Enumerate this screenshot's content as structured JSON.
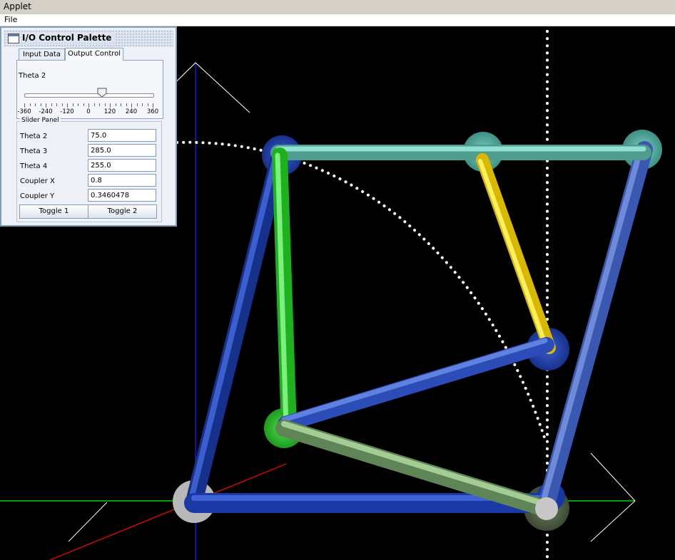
{
  "window": {
    "title": "Applet"
  },
  "menu": {
    "file_label": "File"
  },
  "palette": {
    "title": "I/O Control Palette",
    "tabs": [
      {
        "label": "Input Data"
      },
      {
        "label": "Output Control"
      }
    ],
    "active_tab": "Output Control",
    "slider": {
      "label": "Theta 2",
      "min": -360,
      "max": 360,
      "value": 75,
      "tick_labels": [
        "-360",
        "-240",
        "-120",
        "0",
        "120",
        "240",
        "360"
      ]
    },
    "slider_panel": {
      "title": "Slider Panel",
      "rows": [
        {
          "label": "Theta 2",
          "value": "75.0"
        },
        {
          "label": "Theta 3",
          "value": "285.0"
        },
        {
          "label": "Theta 4",
          "value": "255.0"
        },
        {
          "label": "Coupler X",
          "value": "0.8"
        },
        {
          "label": "Coupler Y",
          "value": "0.3460478"
        }
      ]
    },
    "buttons": {
      "toggle1": "Toggle 1",
      "toggle2": "Toggle 2"
    }
  },
  "colors": {
    "background": "#000000",
    "ground_link": "#1e3fa8",
    "crank_link": "#2ec82e",
    "coupler_top": "#5fb8a8",
    "rocker_link": "#e6c800",
    "output_link": "#4a6bc0",
    "coupler_link": "#7fa875",
    "x_axis": "#00ff00",
    "y_axis": "#1a1aff",
    "z_axis": "#ff0000"
  }
}
